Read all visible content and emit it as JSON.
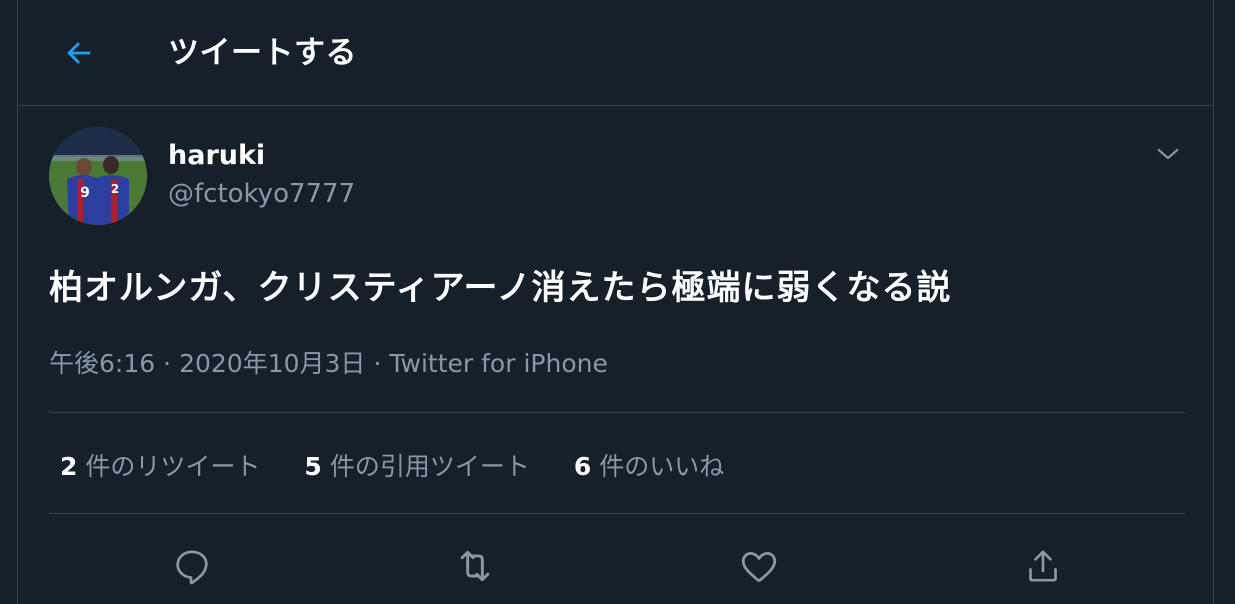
{
  "header": {
    "title": "ツイートする",
    "back_icon": "arrow-left-icon"
  },
  "colors": {
    "background": "#15202b",
    "accent": "#1da1f2",
    "muted": "#8899a6",
    "border": "#38444d"
  },
  "tweet": {
    "author": {
      "display_name": "haruki",
      "handle": "@fctokyo7777"
    },
    "text": "柏オルンガ、クリスティアーノ消えたら極端に弱くなる説",
    "time": "午後6:16",
    "date": "2020年10月3日",
    "separator": "·",
    "source": "Twitter for iPhone"
  },
  "stats": [
    {
      "count": "2",
      "label": "件のリツイート"
    },
    {
      "count": "5",
      "label": "件の引用ツイート"
    },
    {
      "count": "6",
      "label": "件のいいね"
    }
  ],
  "actions": [
    {
      "icon": "reply-icon"
    },
    {
      "icon": "retweet-icon"
    },
    {
      "icon": "like-heart-icon"
    },
    {
      "icon": "share-icon"
    }
  ]
}
